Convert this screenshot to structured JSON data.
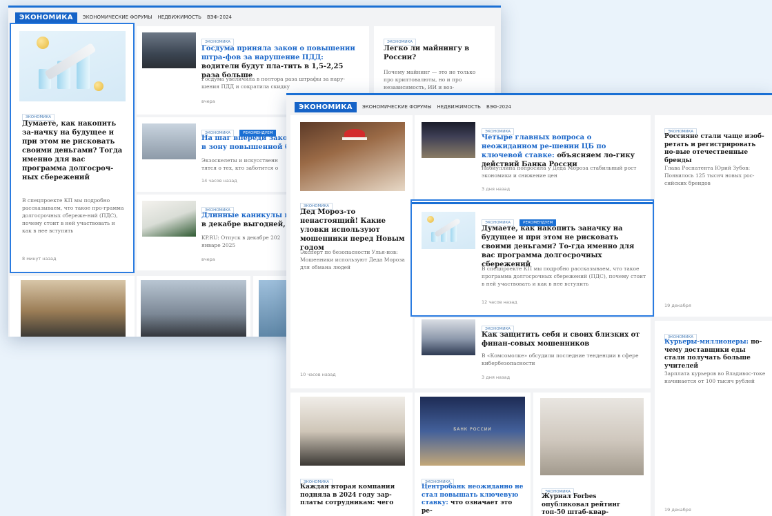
{
  "nav": {
    "brand": "ЭКОНОМИКА",
    "links": [
      "ЭКОНОМИЧЕСКИЕ ФОРУМЫ",
      "НЕДВИЖИМОСТЬ",
      "ВЭФ-2024"
    ]
  },
  "colors": {
    "accent": "#1a6fd4",
    "brand_bg": "#1663c7",
    "highlight": "#2a7be0"
  },
  "back": {
    "feature": {
      "tag": "ЭКОНОМИКА",
      "title": "Думаете, как накопить за-начку на будущее и при этом не рисковать своими деньгами? Тогда именно для вас программа долгосроч-ных сбережений",
      "lead": "В спецпроекте КП мы подробно рассказываем, что такое про-грамма долгосрочных сбереже-ний (ПДС), почему стоит в ней участвовать и как в нее вступить",
      "time": "8 минут назад"
    },
    "duma": {
      "tag": "ЭКОНОМИКА",
      "title_blue": "Госдума приняла закон о повышении штра-фов за нарушение ПДД:",
      "title_rest": " водители будут пла-тить в 1,5-2,25 раза больше",
      "lead": "Госдума увеличила в полтора раза штрафы за нару-шения ПДД и сократила скидку",
      "time": "вчера"
    },
    "mining": {
      "tag": "ЭКОНОМИКА",
      "title": "Легко ли майнингу в России?",
      "lead": "Почему майнинг — это не только про криптовалюты, но и про независимость, ИИ и воз-"
    },
    "step": {
      "tag1": "ЭКОНОМИКА",
      "tag2": "РЕКОМЕНДУЕМ",
      "title": "На шаг впереди закона:",
      "title2": "в зону повышенной безо",
      "lead": "Экзоскелеты и искусственн",
      "lead2": "тятся о тех, кто заботится о",
      "time": "14 часов назад"
    },
    "holidays": {
      "tag": "ЭКОНОМИКА",
      "title": "Длинные каникулы вне",
      "title2": "в декабре выгодней, чем",
      "lead": "KP.RU: Отпуск в декабре 202",
      "lead2": "январе 2025",
      "time": "вчера"
    }
  },
  "front": {
    "ded": {
      "tag": "ЭКОНОМИКА",
      "title": "Дед Мороз-то ненастоящий! Какие уловки используют мошенники перед Новым годом",
      "lead": "Эксперт по безопасности Улья-нов: Мошенники используют Деда Мороза для обмана людей",
      "time": "10 часов назад"
    },
    "cb": {
      "tag": "ЭКОНОМИКА",
      "title_blue": "Четыре главных вопроса о неожиданном ре-шении ЦБ по ключевой ставке:",
      "title_rest": " объясняем ло-гику действий Банка России",
      "lead": "Набиуллина попросила у Деда Мороза стабильный рост экономики и снижение цен",
      "time": "3 дня назад"
    },
    "brands": {
      "tag": "ЭКОНОМИКА",
      "title": "Россияне стали чаще изоб-ретать и регистрировать но-вые отечественные бренды",
      "lead": "Глава Роспатента Юрий Зубов: Появилось 125 тысяч новых рос-сийских брендов",
      "time": "19 декабря"
    },
    "pds": {
      "tag1": "ЭКОНОМИКА",
      "tag2": "РЕКОМЕНДУЕМ",
      "title": "Думаете, как накопить заначку на будущее и при этом не рисковать своими деньгами? То-гда именно для вас программа долгосрочных сбережений",
      "lead": "В спецпроекте КП мы подробно рассказываем, что такое программа долгосрочных сбережений (ПДС), почему стоит в ней участвовать и как в нее вступить",
      "time": "12 часов назад"
    },
    "fraud": {
      "tag": "ЭКОНОМИКА",
      "title": "Как защитить себя и своих близких от финан-совых мошенников",
      "lead": "В «Комсомолке» обсудили последние тенденции в сфере кибербезопасности",
      "time": "3 дня назад"
    },
    "couriers": {
      "tag": "ЭКОНОМИКА",
      "title_blue": "Курьеры-миллионеры:",
      "title_rest": " по-чему доставщики еды стали получать больше учителей",
      "lead": "Зарплата курьеров во Владивос-токе начинается от 100 тысяч рублей",
      "time": "19 декабря"
    },
    "salary": {
      "tag": "ЭКОНОМИКА",
      "title": "Каждая вторая компания подняла в 2024 году зар-платы сотрудникам: чего"
    },
    "rate": {
      "tag": "ЭКОНОМИКА",
      "title_blue": "Центробанк неожиданно не стал повышать ключевую ставку:",
      "title_rest": " что означает это ре-"
    },
    "forbes": {
      "tag": "ЭКОНОМИКА",
      "title": "Журнал Forbes опубликовал рейтинг топ-50 штаб-квар-"
    },
    "bank_sign": "БАНК РОССИИ"
  }
}
